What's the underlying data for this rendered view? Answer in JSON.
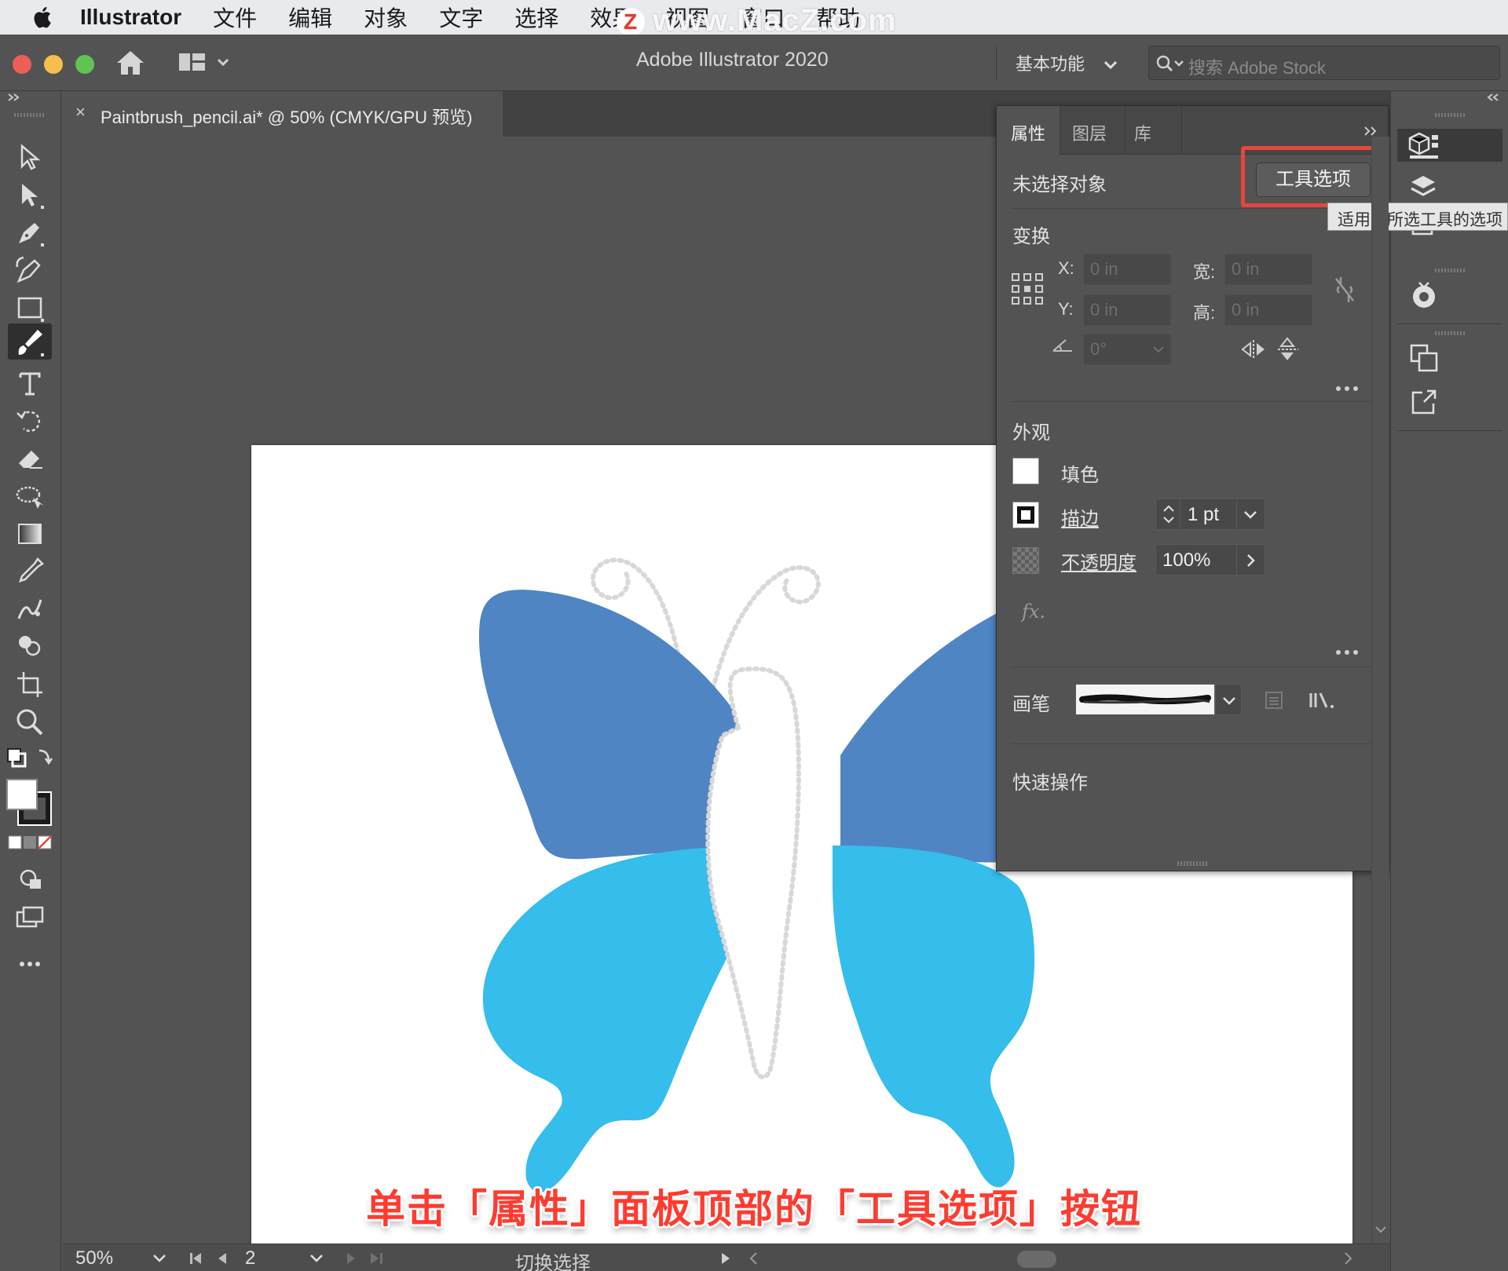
{
  "menubar": {
    "app_name": "Illustrator",
    "items": [
      "文件",
      "编辑",
      "对象",
      "文字",
      "选择",
      "效果",
      "视图",
      "窗口",
      "帮助"
    ]
  },
  "watermark": {
    "text": "www.MacZ.com",
    "logo": "Z"
  },
  "titlebar": {
    "title": "Adobe Illustrator 2020",
    "workspace": "基本功能",
    "search_placeholder": "搜索 Adobe Stock"
  },
  "document_tab": {
    "close": "×",
    "title": "Paintbrush_pencil.ai* @ 50% (CMYK/GPU 预览)"
  },
  "properties_panel": {
    "tabs": [
      "属性",
      "图层",
      "库"
    ],
    "no_selection": "未选择对象",
    "tool_options_button": "工具选项",
    "tooltip": "适用于所选工具的选项",
    "transform": {
      "heading": "变换",
      "x_label": "X:",
      "x_value": "0 in",
      "y_label": "Y:",
      "y_value": "0 in",
      "w_label": "宽:",
      "w_value": "0 in",
      "h_label": "高:",
      "h_value": "0 in",
      "angle_value": "0°"
    },
    "appearance": {
      "heading": "外观",
      "fill_label": "填色",
      "stroke_label": "描边",
      "stroke_value": "1 pt",
      "opacity_label": "不透明度",
      "opacity_value": "100%",
      "fx_label": "fx."
    },
    "brush": {
      "label": "画笔"
    },
    "quick_actions": {
      "heading": "快速操作"
    }
  },
  "statusbar": {
    "zoom": "50%",
    "artboard_number": "2",
    "mode": "切换选择"
  },
  "caption": "单击「属性」面板顶部的「工具选项」按钮",
  "colors": {
    "upper_wing": "#5085c3",
    "lower_wing": "#35bdec",
    "highlight": "#e8453c",
    "caption": "#ff3b2f"
  }
}
